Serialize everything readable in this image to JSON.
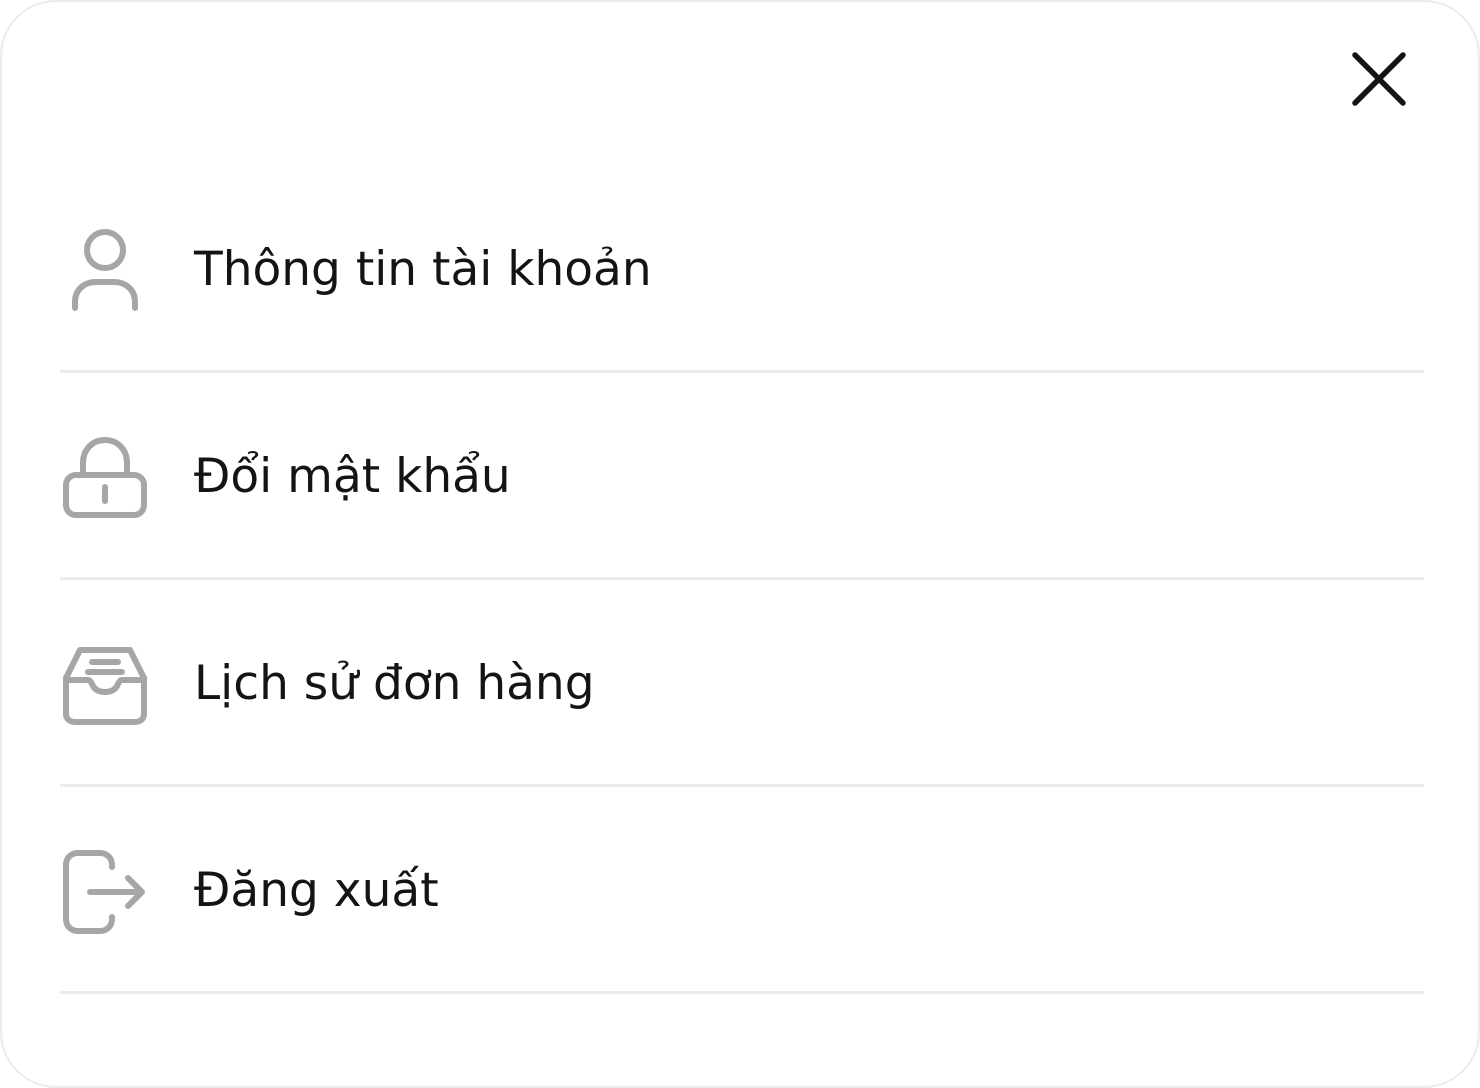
{
  "close": {
    "icon": "close-icon"
  },
  "menu": {
    "items": [
      {
        "label": "Thông tin tài khoản",
        "icon": "user-icon"
      },
      {
        "label": "Đổi mật khẩu",
        "icon": "lock-icon"
      },
      {
        "label": "Lịch sử đơn hàng",
        "icon": "inbox-icon"
      },
      {
        "label": "Đăng xuất",
        "icon": "logout-icon"
      }
    ]
  },
  "colors": {
    "icon": "#a6a6a6",
    "text": "#141414",
    "divider": "#ececec",
    "close": "#141414"
  }
}
